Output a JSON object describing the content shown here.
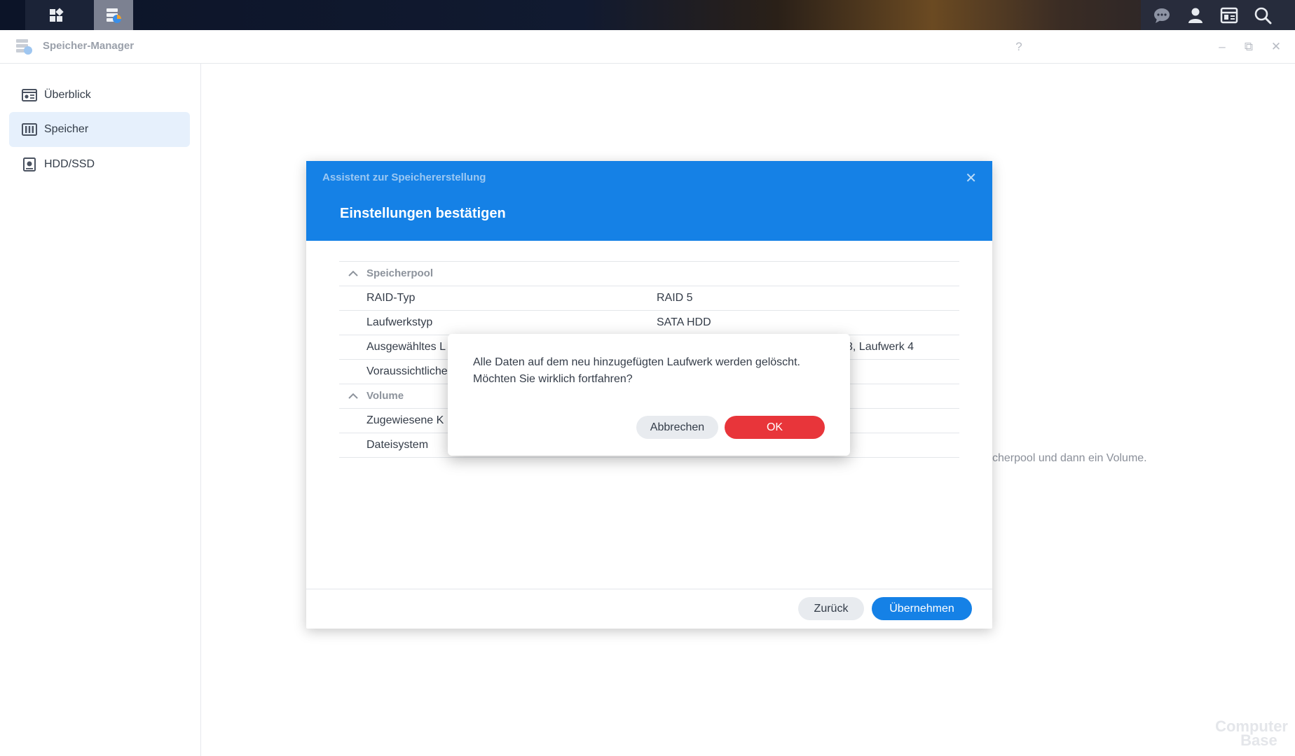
{
  "taskbar": {
    "left_icons": [
      "main-menu-icon",
      "storage-manager-app-icon"
    ],
    "right_icons": [
      "chat-icon",
      "user-icon",
      "widgets-icon",
      "search-icon"
    ]
  },
  "window": {
    "title": "Speicher-Manager",
    "controls": {
      "help": "?",
      "minimize": "–",
      "restore": "⧉",
      "close": "✕"
    }
  },
  "sidebar": {
    "items": [
      {
        "label": "Überblick",
        "icon": "overview-icon",
        "selected": false
      },
      {
        "label": "Speicher",
        "icon": "storage-icon",
        "selected": true
      },
      {
        "label": "HDD/SSD",
        "icon": "hdd-icon",
        "selected": false
      }
    ]
  },
  "background": {
    "hint_text": "cherpool und dann ein Volume."
  },
  "wizard": {
    "subtitle": "Assistent zur Speichererstellung",
    "title": "Einstellungen bestätigen",
    "close": "✕",
    "sections": [
      {
        "name": "Speicherpool",
        "rows": [
          {
            "key": "RAID-Typ",
            "value": "RAID 5"
          },
          {
            "key": "Laufwerkstyp",
            "value": "SATA HDD"
          },
          {
            "key": "Ausgewähltes L",
            "value": "",
            "value_right": "3, Laufwerk 4"
          },
          {
            "key": "Voraussichtliche",
            "value": ""
          }
        ]
      },
      {
        "name": "Volume",
        "rows": [
          {
            "key": "Zugewiesene K",
            "value": ""
          },
          {
            "key": "Dateisystem",
            "value": ""
          }
        ]
      }
    ],
    "buttons": {
      "back": "Zurück",
      "apply": "Übernehmen"
    }
  },
  "confirm_dialog": {
    "message": "Alle Daten auf dem neu hinzugefügten Laufwerk werden gelöscht. Möchten Sie wirklich fortfahren?",
    "buttons": {
      "cancel": "Abbrechen",
      "ok": "OK"
    }
  },
  "watermark": {
    "line1": "Computer",
    "line2": "Base"
  },
  "colors": {
    "accent": "#1581e6",
    "danger": "#e8353a",
    "selected_bg": "#e6f0fc"
  }
}
